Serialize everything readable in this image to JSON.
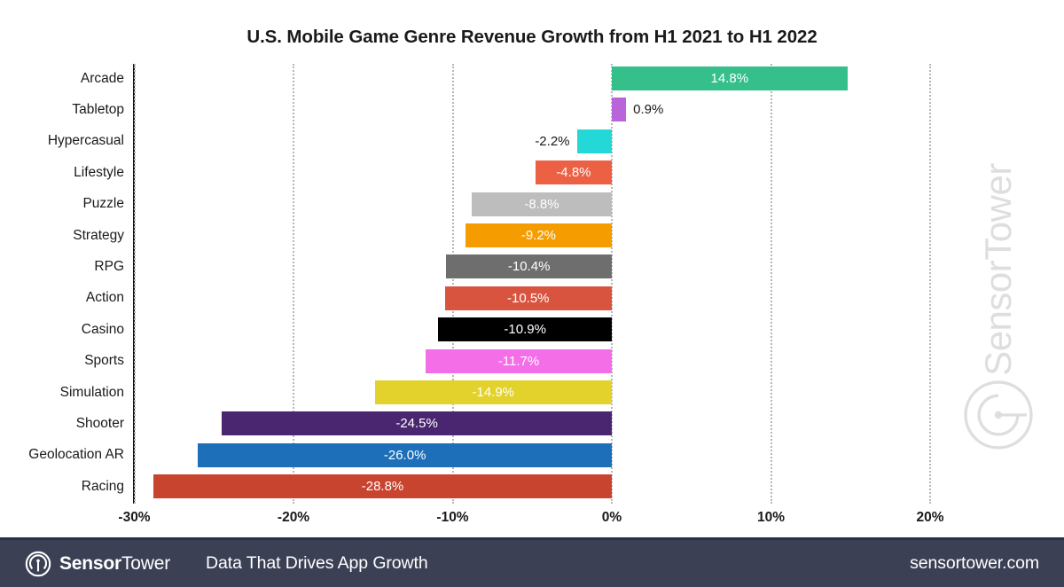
{
  "chart_data": {
    "type": "bar",
    "orientation": "horizontal",
    "title": "U.S. Mobile Game Genre Revenue Growth from H1 2021 to H1 2022",
    "xlabel": "",
    "ylabel": "",
    "xlim": [
      -30,
      25
    ],
    "xticks": [
      -30,
      -20,
      -10,
      0,
      10,
      20
    ],
    "xtick_labels": [
      "-30%",
      "-20%",
      "-10%",
      "0%",
      "10%",
      "20%"
    ],
    "grid": "vertical-dotted",
    "legend": "none",
    "categories": [
      "Arcade",
      "Tabletop",
      "Hypercasual",
      "Lifestyle",
      "Puzzle",
      "Strategy",
      "RPG",
      "Action",
      "Casino",
      "Sports",
      "Simulation",
      "Shooter",
      "Geolocation AR",
      "Racing"
    ],
    "values": [
      14.8,
      0.9,
      -2.2,
      -4.8,
      -8.8,
      -9.2,
      -10.4,
      -10.5,
      -10.9,
      -11.7,
      -14.9,
      -24.5,
      -26.0,
      -28.8
    ],
    "value_labels": [
      "14.8%",
      "0.9%",
      "-2.2%",
      "-4.8%",
      "-8.8%",
      "-9.2%",
      "-10.4%",
      "-10.5%",
      "-10.9%",
      "-11.7%",
      "-14.9%",
      "-24.5%",
      "-26.0%",
      "-28.8%"
    ],
    "label_placement": [
      "inside",
      "outside",
      "outside",
      "inside",
      "inside",
      "inside",
      "inside",
      "inside",
      "inside",
      "inside",
      "inside",
      "inside",
      "inside",
      "inside"
    ],
    "colors": [
      "#34bf8b",
      "#b964d9",
      "#25d8d8",
      "#ec6144",
      "#bdbdbd",
      "#f59c00",
      "#6e6e6e",
      "#d9543f",
      "#000000",
      "#f46ee8",
      "#e2d22b",
      "#4a2570",
      "#1c6fb8",
      "#c8442f"
    ]
  },
  "watermark": {
    "text_light": "Sensor",
    "text_bold": "Tower",
    "logo_icon": "sensortower-circle-logo"
  },
  "footer": {
    "logo_icon": "sensortower-circle-logo",
    "brand_bold": "Sensor",
    "brand_light": "Tower",
    "tagline": "Data That Drives App Growth",
    "url": "sensortower.com"
  }
}
